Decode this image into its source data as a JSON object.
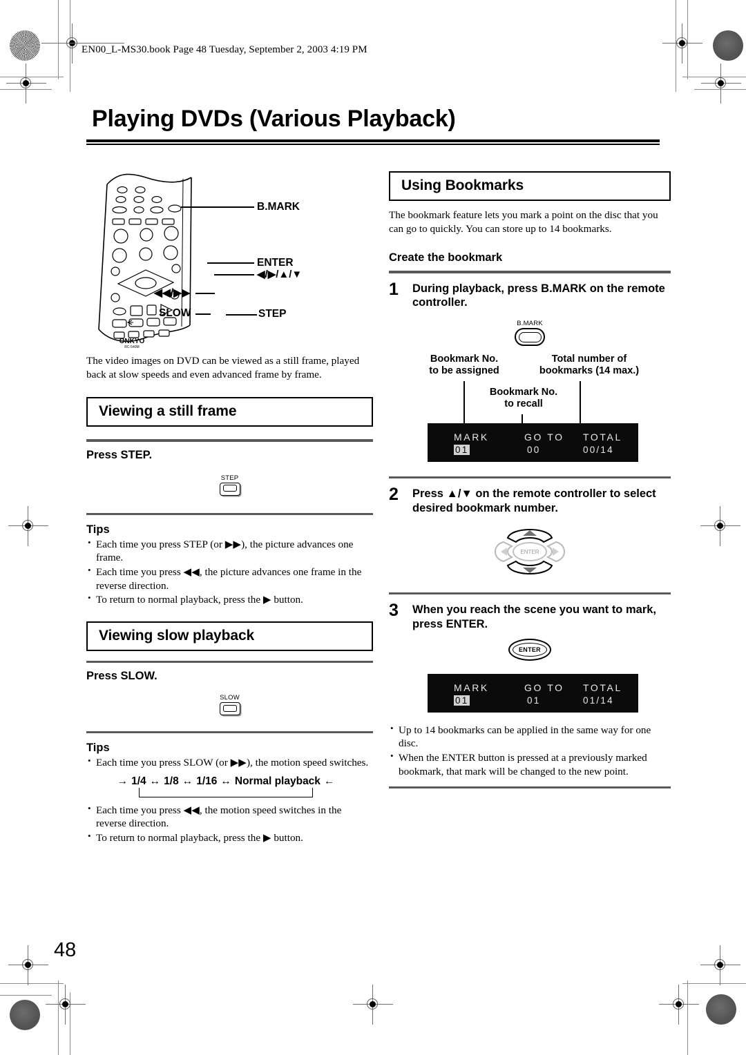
{
  "header": {
    "text": "EN00_L-MS30.book  Page 48  Tuesday, September 2, 2003  4:19 PM"
  },
  "page_title": "Playing DVDs (Various Playback)",
  "page_number": "48",
  "remote_diagram": {
    "labels": {
      "bmark": "B.MARK",
      "enter": "ENTER",
      "dpad": "◀/▶/▲/▼",
      "skip": "◀◀/▶▶",
      "slow": "SLOW",
      "step": "STEP"
    },
    "brand": "ONKYO",
    "model": "RC-540M"
  },
  "left_column": {
    "intro": "The video images on DVD can be viewed as a still frame, played back at slow speeds and even advanced frame by frame.",
    "section_still": {
      "heading": "Viewing a still frame",
      "instruction": "Press STEP.",
      "key_label": "STEP",
      "tips_title": "Tips",
      "tips": [
        "Each time you press STEP (or ▶▶), the picture advances one frame.",
        "Each time you press ◀◀, the picture advances one frame in the reverse direction.",
        "To return to normal playback, press the ▶ button."
      ]
    },
    "section_slow": {
      "heading": "Viewing slow playback",
      "instruction": "Press SLOW.",
      "key_label": "SLOW",
      "tips_title": "Tips",
      "tip_first": "Each time you press SLOW (or ▶▶), the motion speed switches.",
      "flow": {
        "arrow_in": "→",
        "items": [
          "1/4",
          "1/8",
          "1/16",
          "Normal playback"
        ],
        "sep": "↔",
        "arrow_out": "←"
      },
      "tips_rest": [
        "Each time you press ◀◀, the motion speed switches in the reverse direction.",
        "To return to normal playback, press the ▶ button."
      ]
    }
  },
  "right_column": {
    "section_heading": "Using Bookmarks",
    "intro": "The bookmark feature lets you mark a point on the disc that you can go to quickly. You can store up to 14 bookmarks.",
    "subheading": "Create the bookmark",
    "steps": [
      {
        "number": "1",
        "text": "During playback, press B.MARK on the remote controller.",
        "key_label": "B.MARK"
      },
      {
        "number": "2",
        "text": "Press ▲/▼ on the remote controller to select desired bookmark number.",
        "key_label": "ENTER"
      },
      {
        "number": "3",
        "text": "When you reach the scene you want to mark, press ENTER.",
        "key_label": "ENTER"
      }
    ],
    "osd_callouts": {
      "assigned": "Bookmark No.\nto be assigned",
      "assigned_l1": "Bookmark No.",
      "assigned_l2": "to be assigned",
      "total_l1": "Total number of",
      "total_l2": "bookmarks (14 max.)",
      "recall_l1": "Bookmark No.",
      "recall_l2": "to recall"
    },
    "osd_first": {
      "labels": [
        "MARK",
        "GO TO",
        "TOTAL"
      ],
      "values": [
        "01",
        "00",
        "00/14"
      ],
      "highlight_index": 0
    },
    "osd_second": {
      "labels": [
        "MARK",
        "GO TO",
        "TOTAL"
      ],
      "values": [
        "01",
        "01",
        "01/14"
      ],
      "highlight_index": 0
    },
    "notes": [
      "Up to 14 bookmarks can be applied in the same way for one disc.",
      "When the ENTER button is pressed at a previously marked bookmark, that mark will be changed to the new point."
    ]
  },
  "colors": {
    "rule": "#595959",
    "osd_bg": "#0b0b0b",
    "osd_text": "#e9e9e9",
    "highlight": "#d2d2d2"
  }
}
